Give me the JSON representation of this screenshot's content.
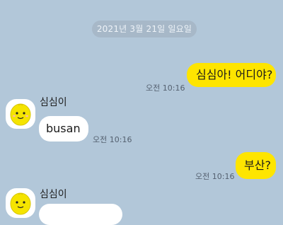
{
  "date_divider": "2021년 3월 21일 일요일",
  "messages": [
    {
      "direction": "outgoing",
      "text": "심심아! 어디야?",
      "time": "오전 10:16"
    },
    {
      "direction": "incoming",
      "sender": "심심이",
      "text": "busan",
      "time": "오전 10:16",
      "avatar": "simsimi-avatar"
    },
    {
      "direction": "outgoing",
      "text": "부산?",
      "time": "오전 10:16"
    },
    {
      "direction": "incoming",
      "sender": "심심이",
      "text": "",
      "avatar": "simsimi-avatar"
    }
  ],
  "colors": {
    "background": "#b2c7d9",
    "outgoing_bubble": "#fee500",
    "incoming_bubble": "#ffffff",
    "avatar_character": "#f5e400"
  }
}
